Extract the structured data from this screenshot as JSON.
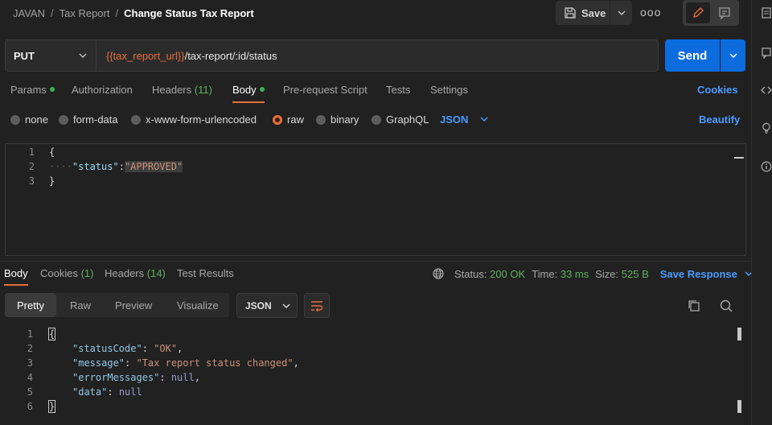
{
  "breadcrumb": {
    "workspace": "JAVAN",
    "collection": "Tax Report",
    "request": "Change Status Tax Report",
    "separator": "/"
  },
  "header": {
    "save_label": "Save",
    "more_label": "ooo"
  },
  "request": {
    "method": "PUT",
    "url_variable": "{{tax_report_url}}",
    "url_path": "/tax-report/:id/status",
    "send_label": "Send"
  },
  "request_tabs": {
    "params": "Params",
    "authorization": "Authorization",
    "headers": "Headers",
    "headers_count": "(11)",
    "body": "Body",
    "pre_request": "Pre-request Script",
    "tests": "Tests",
    "settings": "Settings",
    "cookies": "Cookies"
  },
  "body_types": {
    "none": "none",
    "form_data": "form-data",
    "urlencoded": "x-www-form-urlencoded",
    "raw": "raw",
    "binary": "binary",
    "graphql": "GraphQL",
    "format": "JSON",
    "beautify": "Beautify"
  },
  "request_body": {
    "line_numbers": [
      "1",
      "2",
      "3"
    ],
    "open": "{",
    "indent": "····",
    "key": "\"status\"",
    "colon": ":",
    "value": "\"APPROVED\"",
    "close": "}"
  },
  "response_tabs": {
    "body": "Body",
    "cookies": "Cookies",
    "cookies_count": "(1)",
    "headers": "Headers",
    "headers_count": "(14)",
    "test_results": "Test Results"
  },
  "response_status": {
    "status_label": "Status:",
    "status_value": "200 OK",
    "time_label": "Time:",
    "time_value": "33 ms",
    "size_label": "Size:",
    "size_value": "525 B",
    "save_response": "Save Response"
  },
  "response_views": {
    "pretty": "Pretty",
    "raw": "Raw",
    "preview": "Preview",
    "visualize": "Visualize",
    "format": "JSON"
  },
  "response_body": {
    "line_numbers": [
      "1",
      "2",
      "3",
      "4",
      "5",
      "6"
    ],
    "open": "{",
    "lines": [
      {
        "key": "\"statusCode\"",
        "value": "\"OK\"",
        "comma": ","
      },
      {
        "key": "\"message\"",
        "value": "\"Tax report status changed\"",
        "comma": ","
      },
      {
        "key": "\"errorMessages\"",
        "value": "null",
        "comma": ","
      },
      {
        "key": "\"data\"",
        "value": "null",
        "comma": ""
      }
    ],
    "close": "}"
  },
  "colors": {
    "accent": "#e46e3c",
    "primary": "#0c6cde",
    "link": "#4a9bff",
    "success": "#5fb15f"
  }
}
